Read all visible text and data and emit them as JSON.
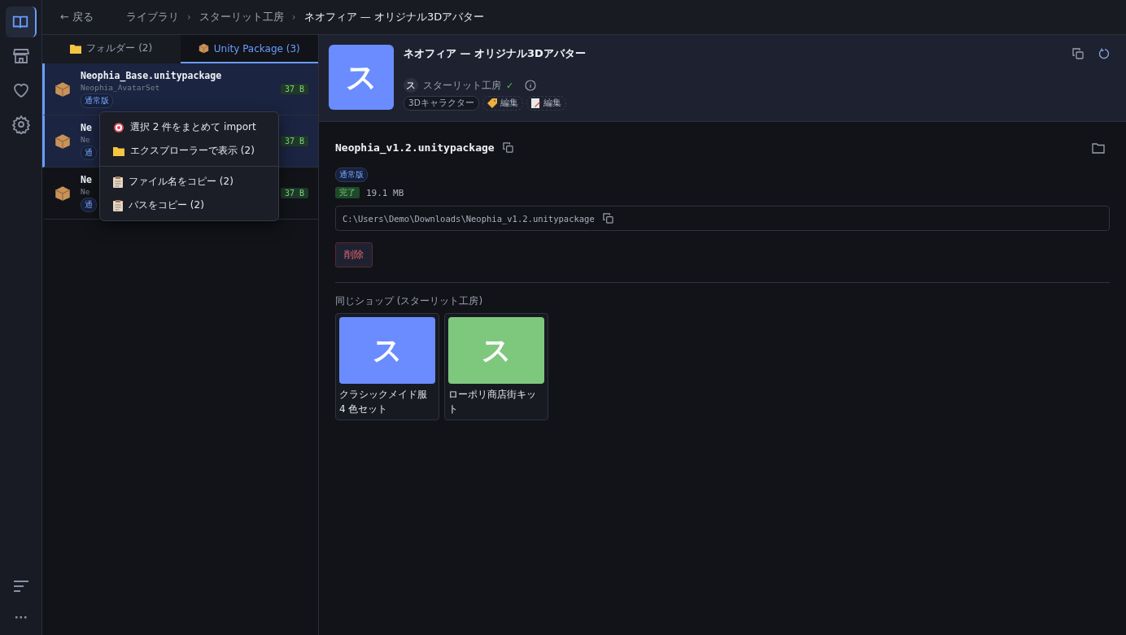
{
  "nav": [
    {
      "selected": true
    },
    {
      "selected": false
    },
    {
      "selected": false
    },
    {
      "selected": false
    }
  ],
  "topbar": {
    "back": "← 戻る",
    "breadcrumbs": [
      "ライブラリ",
      "スターリット工房",
      "ネオフィア — オリジナル3Dアバター"
    ],
    "separator": "›"
  },
  "tabs": [
    {
      "label": "フォルダー (2)",
      "selected": false
    },
    {
      "label": "Unity Package (3)",
      "selected": true
    }
  ],
  "files": [
    {
      "name": "Neophia_Base.unitypackage",
      "subtitle": "Neophia_AvatarSet",
      "tag": "通常版",
      "size": "37 B",
      "selected": true
    },
    {
      "name": "Ne",
      "subtitle": "Ne",
      "tag": "通",
      "size": "37 B",
      "selected": true
    },
    {
      "name": "Ne",
      "subtitle": "Ne",
      "tag": "通",
      "size": "37 B",
      "selected": false
    }
  ],
  "context_menu": {
    "sections": [
      [
        {
          "label": "選択 2 件をまとめて import"
        },
        {
          "label": "エクスプローラーで表示 (2)"
        }
      ],
      [
        {
          "label": "ファイル名をコピー (2)"
        },
        {
          "label": "パスをコピー (2)"
        }
      ]
    ]
  },
  "product": {
    "thumbnail": "ス",
    "title": "ネオフィア — オリジナル3Dアバター",
    "shop": "スターリット工房",
    "shop_initial": "ス",
    "verified": "✓",
    "tags": [
      {
        "label": "3Dキャラクター",
        "kind": "category"
      },
      {
        "label": "編集",
        "kind": "tag-edit"
      },
      {
        "label": "編集",
        "kind": "note-edit"
      }
    ]
  },
  "detail": {
    "filename": "Neophia_v1.2.unitypackage",
    "edition": "通常版",
    "status": "完了",
    "size": "19.1 MB",
    "path": "C:\\Users\\Demo\\Downloads\\Neophia_v1.2.unitypackage",
    "delete": "削除"
  },
  "same_shop": {
    "heading": "同じショップ (スターリット工房)",
    "items": [
      {
        "initial": "ス",
        "title": "クラシックメイド服 4 色セット",
        "color": "#6b8cff"
      },
      {
        "initial": "ス",
        "title": "ローポリ商店街キット",
        "color": "#7ec87e"
      }
    ]
  }
}
